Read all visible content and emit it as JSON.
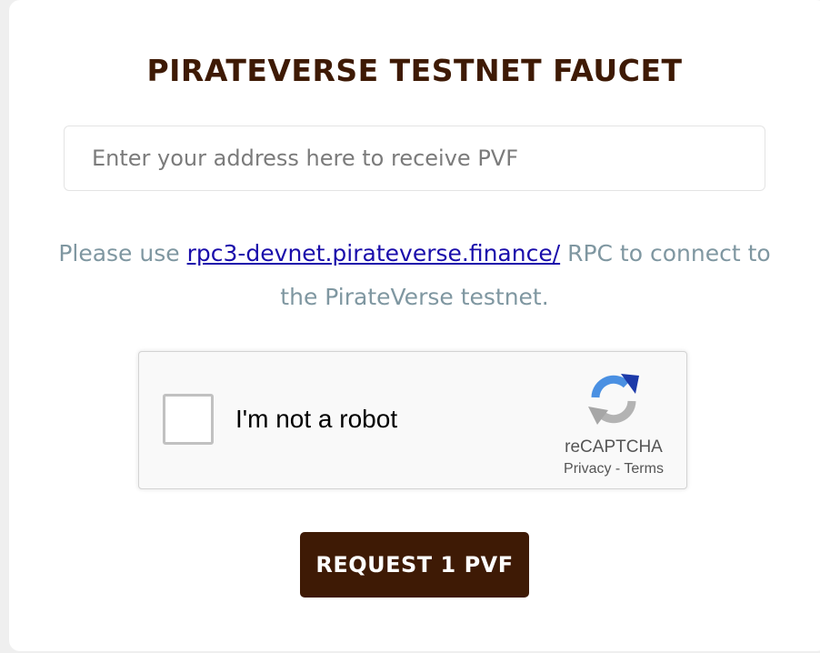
{
  "faucet": {
    "title": "PIRATEVERSE TESTNET FAUCET",
    "address_input": {
      "value": "",
      "placeholder": "Enter your address here to receive PVF"
    },
    "info": {
      "prefix": "Please use ",
      "link_text": "rpc3-devnet.pirateverse.finance/",
      "suffix": " RPC to connect to the PirateVerse testnet."
    },
    "request_button_label": "REQUEST 1 PVF"
  },
  "recaptcha": {
    "label": "I'm not a robot",
    "brand": "reCAPTCHA",
    "privacy_link": "Privacy",
    "separator": " - ",
    "terms_link": "Terms",
    "checked": false,
    "logo_icon": "recaptcha-logo-icon"
  },
  "colors": {
    "brand_dark": "#3e1a05",
    "info_text": "#7f97a1",
    "link": "#1a0dab"
  }
}
